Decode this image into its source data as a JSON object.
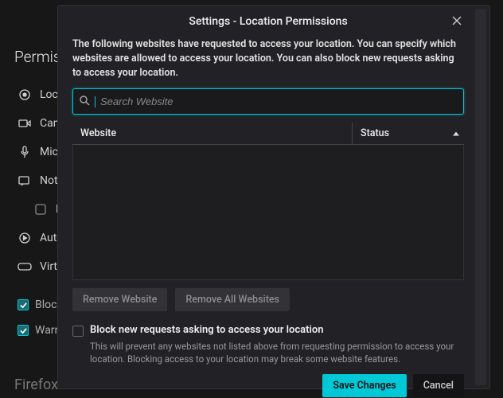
{
  "bg": {
    "section_title": "Permissions",
    "items": [
      {
        "icon": "location",
        "label": "Location"
      },
      {
        "icon": "camera",
        "label": "Camera"
      },
      {
        "icon": "mic",
        "label": "Microphone"
      },
      {
        "icon": "notif",
        "label": "Notifications"
      }
    ],
    "pause_label": "Pause",
    "autoplay_label": "Autoplay",
    "vr_label": "Virtual Reality",
    "blockp_label": "Block pop-up windows",
    "warn_label": "Warn you when websites try to install add-ons",
    "footer": "Firefox Data Collection and Use"
  },
  "modal": {
    "title": "Settings - Location Permissions",
    "desc": "The following websites have requested to access your location. You can specify which websites are allowed to access your location. You can also block new requests asking to access your location.",
    "search_placeholder": "Search Website",
    "col_website": "Website",
    "col_status": "Status",
    "remove_website": "Remove Website",
    "remove_all": "Remove All Websites",
    "block_checkbox_label": "Block new requests asking to access your location",
    "block_desc": "This will prevent any websites not listed above from requesting permission to access your location. Blocking access to your location may break some website features.",
    "save": "Save Changes",
    "cancel": "Cancel"
  }
}
